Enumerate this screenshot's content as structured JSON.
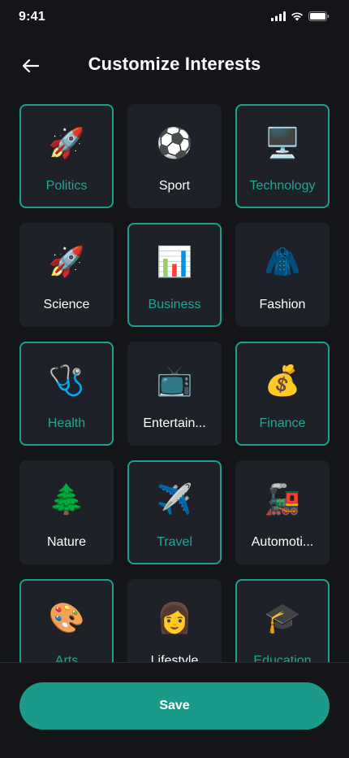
{
  "status_bar": {
    "time": "9:41",
    "icons": [
      "cellular-signal-icon",
      "wifi-icon",
      "battery-icon"
    ]
  },
  "header": {
    "back_icon": "arrow-left-icon",
    "title": "Customize Interests"
  },
  "colors": {
    "background": "#141519",
    "tile": "#1f2129",
    "accent": "#1e9f8e",
    "selected_text": "#22a595",
    "save_button": "#1b9a89"
  },
  "interests": [
    {
      "label": "Politics",
      "emoji": "🚀",
      "icon": "rocket-icon",
      "selected": true
    },
    {
      "label": "Sport",
      "emoji": "⚽",
      "icon": "soccer-ball-icon",
      "selected": false
    },
    {
      "label": "Technology",
      "emoji": "🖥️",
      "icon": "desktop-computer-icon",
      "selected": true
    },
    {
      "label": "Science",
      "emoji": "🚀",
      "icon": "rocket-icon",
      "selected": false
    },
    {
      "label": "Business",
      "emoji": "📊",
      "icon": "bar-chart-icon",
      "selected": true
    },
    {
      "label": "Fashion",
      "emoji": "🧥",
      "icon": "coat-icon",
      "selected": false
    },
    {
      "label": "Health",
      "emoji": "🩺",
      "icon": "stethoscope-icon",
      "selected": true
    },
    {
      "label": "Entertain...",
      "emoji": "📺",
      "icon": "television-icon",
      "selected": false
    },
    {
      "label": "Finance",
      "emoji": "💰",
      "icon": "money-bag-icon",
      "selected": true
    },
    {
      "label": "Nature",
      "emoji": "🌲",
      "icon": "evergreen-tree-icon",
      "selected": false
    },
    {
      "label": "Travel",
      "emoji": "✈️",
      "icon": "airplane-icon",
      "selected": true
    },
    {
      "label": "Automoti...",
      "emoji": "🚂",
      "icon": "locomotive-icon",
      "selected": false
    },
    {
      "label": "Arts",
      "emoji": "🎨",
      "icon": "artist-palette-icon",
      "selected": true
    },
    {
      "label": "Lifestyle",
      "emoji": "👩",
      "icon": "woman-icon",
      "selected": false
    },
    {
      "label": "Education",
      "emoji": "🎓",
      "icon": "graduation-cap-icon",
      "selected": true
    }
  ],
  "footer": {
    "save_label": "Save"
  }
}
